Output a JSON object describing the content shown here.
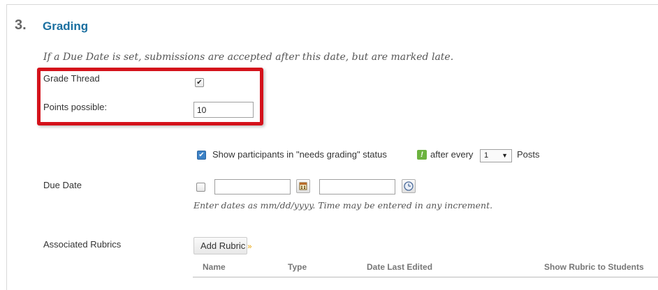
{
  "section": {
    "number": "3.",
    "title": "Grading",
    "instructions": "If a Due Date is set, submissions are accepted after this date, but are marked late."
  },
  "grade_thread": {
    "label": "Grade Thread",
    "checked": true
  },
  "points_possible": {
    "label": "Points possible:",
    "value": "10"
  },
  "needs_grading": {
    "checked": true,
    "label_before": "Show participants in \"needs grading\" status",
    "alert_icon": "exclamation-icon",
    "label_after": "after every",
    "selected": "1",
    "unit": "Posts"
  },
  "due_date": {
    "label": "Due Date",
    "checked": false,
    "date_value": "",
    "time_value": "",
    "hint": "Enter dates as mm/dd/yyyy. Time may be entered in any increment."
  },
  "rubrics": {
    "label": "Associated Rubrics",
    "add_button": "Add Rubric",
    "columns": [
      "Name",
      "Type",
      "Date Last Edited",
      "Show Rubric to Students"
    ]
  },
  "colors": {
    "title": "#1a6fa0",
    "highlight": "#d4121b",
    "alert": "#6cb33f",
    "checkbox_blue": "#3d82c6"
  }
}
